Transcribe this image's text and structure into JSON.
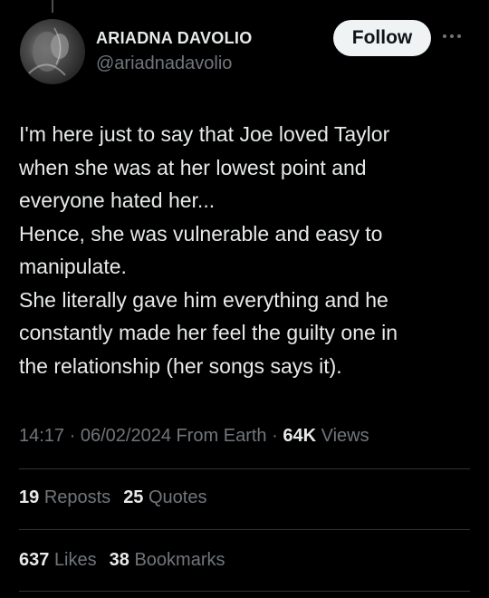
{
  "author": {
    "display_name": "ARIADNA DAVOLIO",
    "handle": "@ariadnadavolio",
    "avatar_icon": "profile-photo"
  },
  "follow_label": "Follow",
  "tweet": {
    "lines": [
      "I'm here just to say that Joe loved Taylor",
      "when she was at her lowest point and",
      "everyone hated her...",
      "Hence, she was vulnerable and easy to",
      "manipulate.",
      "She literally gave him everything and he",
      "constantly made her feel the guilty one in",
      "the relationship (her songs says it)."
    ]
  },
  "meta": {
    "time": "14:17",
    "date": "06/02/2024",
    "source": "From Earth",
    "views_count": "64K",
    "views_label": "Views"
  },
  "stats": {
    "reposts_count": "19",
    "reposts_label": "Reposts",
    "quotes_count": "25",
    "quotes_label": "Quotes",
    "likes_count": "637",
    "likes_label": "Likes",
    "bookmarks_count": "38",
    "bookmarks_label": "Bookmarks"
  },
  "colors": {
    "background": "#000000",
    "text": "#e7e9ea",
    "secondary": "#71767b",
    "divider": "#2f3336",
    "button_bg": "#eff3f4"
  }
}
